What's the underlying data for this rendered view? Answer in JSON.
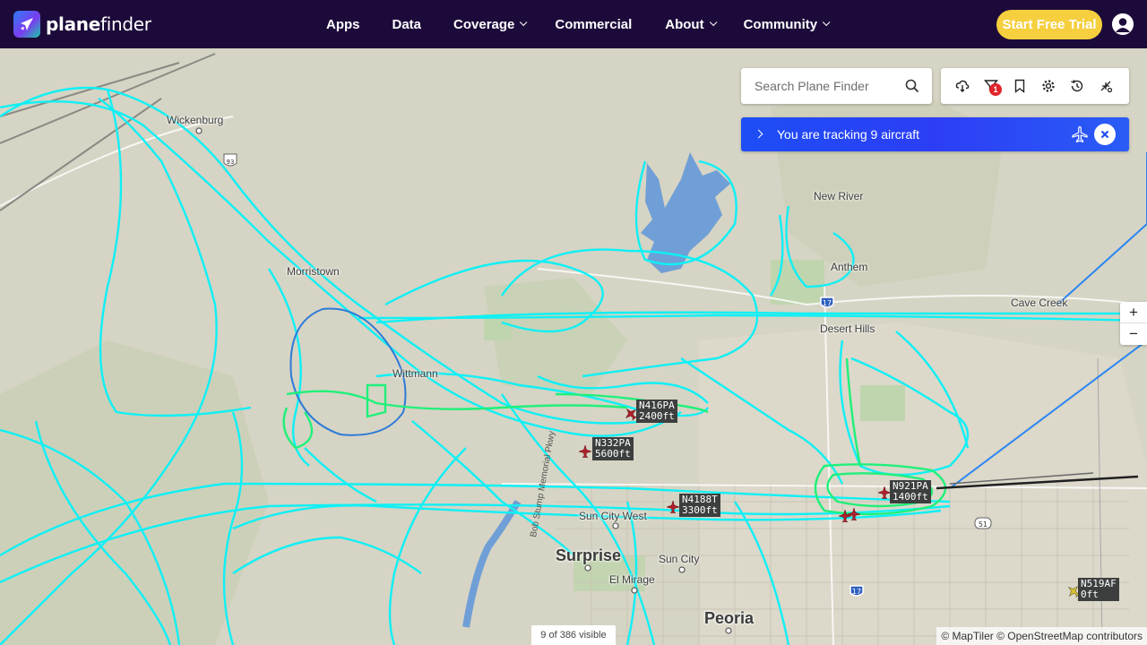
{
  "brand": {
    "name_bold": "plane",
    "name_light": "finder"
  },
  "nav": {
    "items": [
      {
        "label": "Apps",
        "dropdown": false
      },
      {
        "label": "Data",
        "dropdown": false
      },
      {
        "label": "Coverage",
        "dropdown": true
      },
      {
        "label": "Commercial",
        "dropdown": false
      },
      {
        "label": "About",
        "dropdown": true
      },
      {
        "label": "Community",
        "dropdown": true
      }
    ],
    "cta": "Start Free Trial"
  },
  "search": {
    "placeholder": "Search Plane Finder"
  },
  "toolbar": {
    "tools": [
      "weather-icon",
      "filter-icon",
      "bookmark-icon",
      "settings-icon",
      "history-icon",
      "ar-view-icon"
    ],
    "filter_badge": "1"
  },
  "tracking": {
    "text": "You are tracking 9 aircraft"
  },
  "zoom": {
    "in": "+",
    "out": "−"
  },
  "status": {
    "visible_count": "9 of 386 visible"
  },
  "attribution": "© MapTiler © OpenStreetMap contributors",
  "aircraft": [
    {
      "callsign": "N416PA",
      "altitude": "2400ft"
    },
    {
      "callsign": "N332PA",
      "altitude": "5600ft"
    },
    {
      "callsign": "N4188T",
      "altitude": "3300ft"
    },
    {
      "callsign": "N921PA",
      "altitude": "1400ft"
    },
    {
      "callsign": "N519AF",
      "altitude": "0ft"
    }
  ],
  "places": {
    "towns": [
      "Wickenburg",
      "Morristown",
      "Wittmann",
      "New River",
      "Anthem",
      "Desert Hills",
      "Cave Creek",
      "Sun City West",
      "Sun City",
      "El Mirage",
      "Bob Stump Memorial Pkwy"
    ],
    "cities": [
      "Surprise",
      "Peoria"
    ],
    "highways": [
      "17",
      "17",
      "51",
      "93"
    ]
  },
  "colors": {
    "nav_bg": "#1c0b3a",
    "cta_bg": "#f6cf3f",
    "tracking_bg": "#1d4ef5",
    "track_cyan": "#0ff0f5",
    "track_green": "#20f07a",
    "aircraft_red": "#b0202c",
    "map_bg": "#d6d4c4"
  }
}
